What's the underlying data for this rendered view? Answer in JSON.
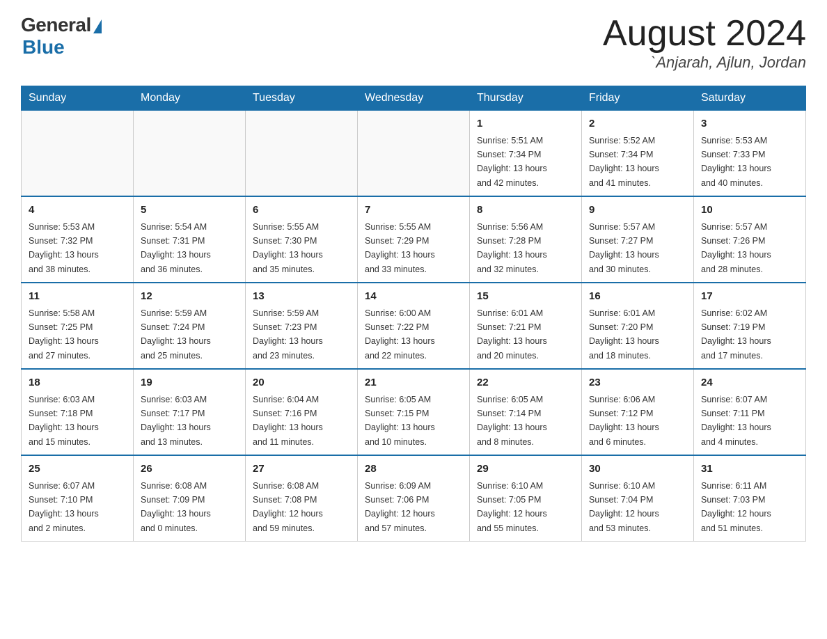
{
  "header": {
    "logo_general": "General",
    "logo_blue": "Blue",
    "month_year": "August 2024",
    "location": "`Anjarah, Ajlun, Jordan"
  },
  "days_of_week": [
    "Sunday",
    "Monday",
    "Tuesday",
    "Wednesday",
    "Thursday",
    "Friday",
    "Saturday"
  ],
  "weeks": [
    [
      {
        "day": "",
        "info": ""
      },
      {
        "day": "",
        "info": ""
      },
      {
        "day": "",
        "info": ""
      },
      {
        "day": "",
        "info": ""
      },
      {
        "day": "1",
        "info": "Sunrise: 5:51 AM\nSunset: 7:34 PM\nDaylight: 13 hours\nand 42 minutes."
      },
      {
        "day": "2",
        "info": "Sunrise: 5:52 AM\nSunset: 7:34 PM\nDaylight: 13 hours\nand 41 minutes."
      },
      {
        "day": "3",
        "info": "Sunrise: 5:53 AM\nSunset: 7:33 PM\nDaylight: 13 hours\nand 40 minutes."
      }
    ],
    [
      {
        "day": "4",
        "info": "Sunrise: 5:53 AM\nSunset: 7:32 PM\nDaylight: 13 hours\nand 38 minutes."
      },
      {
        "day": "5",
        "info": "Sunrise: 5:54 AM\nSunset: 7:31 PM\nDaylight: 13 hours\nand 36 minutes."
      },
      {
        "day": "6",
        "info": "Sunrise: 5:55 AM\nSunset: 7:30 PM\nDaylight: 13 hours\nand 35 minutes."
      },
      {
        "day": "7",
        "info": "Sunrise: 5:55 AM\nSunset: 7:29 PM\nDaylight: 13 hours\nand 33 minutes."
      },
      {
        "day": "8",
        "info": "Sunrise: 5:56 AM\nSunset: 7:28 PM\nDaylight: 13 hours\nand 32 minutes."
      },
      {
        "day": "9",
        "info": "Sunrise: 5:57 AM\nSunset: 7:27 PM\nDaylight: 13 hours\nand 30 minutes."
      },
      {
        "day": "10",
        "info": "Sunrise: 5:57 AM\nSunset: 7:26 PM\nDaylight: 13 hours\nand 28 minutes."
      }
    ],
    [
      {
        "day": "11",
        "info": "Sunrise: 5:58 AM\nSunset: 7:25 PM\nDaylight: 13 hours\nand 27 minutes."
      },
      {
        "day": "12",
        "info": "Sunrise: 5:59 AM\nSunset: 7:24 PM\nDaylight: 13 hours\nand 25 minutes."
      },
      {
        "day": "13",
        "info": "Sunrise: 5:59 AM\nSunset: 7:23 PM\nDaylight: 13 hours\nand 23 minutes."
      },
      {
        "day": "14",
        "info": "Sunrise: 6:00 AM\nSunset: 7:22 PM\nDaylight: 13 hours\nand 22 minutes."
      },
      {
        "day": "15",
        "info": "Sunrise: 6:01 AM\nSunset: 7:21 PM\nDaylight: 13 hours\nand 20 minutes."
      },
      {
        "day": "16",
        "info": "Sunrise: 6:01 AM\nSunset: 7:20 PM\nDaylight: 13 hours\nand 18 minutes."
      },
      {
        "day": "17",
        "info": "Sunrise: 6:02 AM\nSunset: 7:19 PM\nDaylight: 13 hours\nand 17 minutes."
      }
    ],
    [
      {
        "day": "18",
        "info": "Sunrise: 6:03 AM\nSunset: 7:18 PM\nDaylight: 13 hours\nand 15 minutes."
      },
      {
        "day": "19",
        "info": "Sunrise: 6:03 AM\nSunset: 7:17 PM\nDaylight: 13 hours\nand 13 minutes."
      },
      {
        "day": "20",
        "info": "Sunrise: 6:04 AM\nSunset: 7:16 PM\nDaylight: 13 hours\nand 11 minutes."
      },
      {
        "day": "21",
        "info": "Sunrise: 6:05 AM\nSunset: 7:15 PM\nDaylight: 13 hours\nand 10 minutes."
      },
      {
        "day": "22",
        "info": "Sunrise: 6:05 AM\nSunset: 7:14 PM\nDaylight: 13 hours\nand 8 minutes."
      },
      {
        "day": "23",
        "info": "Sunrise: 6:06 AM\nSunset: 7:12 PM\nDaylight: 13 hours\nand 6 minutes."
      },
      {
        "day": "24",
        "info": "Sunrise: 6:07 AM\nSunset: 7:11 PM\nDaylight: 13 hours\nand 4 minutes."
      }
    ],
    [
      {
        "day": "25",
        "info": "Sunrise: 6:07 AM\nSunset: 7:10 PM\nDaylight: 13 hours\nand 2 minutes."
      },
      {
        "day": "26",
        "info": "Sunrise: 6:08 AM\nSunset: 7:09 PM\nDaylight: 13 hours\nand 0 minutes."
      },
      {
        "day": "27",
        "info": "Sunrise: 6:08 AM\nSunset: 7:08 PM\nDaylight: 12 hours\nand 59 minutes."
      },
      {
        "day": "28",
        "info": "Sunrise: 6:09 AM\nSunset: 7:06 PM\nDaylight: 12 hours\nand 57 minutes."
      },
      {
        "day": "29",
        "info": "Sunrise: 6:10 AM\nSunset: 7:05 PM\nDaylight: 12 hours\nand 55 minutes."
      },
      {
        "day": "30",
        "info": "Sunrise: 6:10 AM\nSunset: 7:04 PM\nDaylight: 12 hours\nand 53 minutes."
      },
      {
        "day": "31",
        "info": "Sunrise: 6:11 AM\nSunset: 7:03 PM\nDaylight: 12 hours\nand 51 minutes."
      }
    ]
  ]
}
